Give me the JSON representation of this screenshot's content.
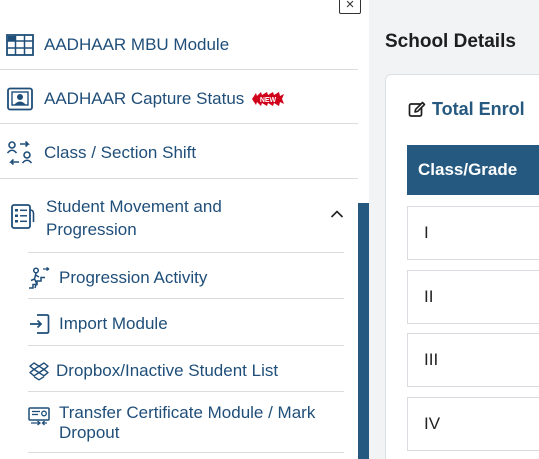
{
  "sidebar": {
    "items": [
      {
        "label": "AADHAAR MBU Module",
        "icon": "table-grid-icon"
      },
      {
        "label": "AADHAAR Capture Status",
        "icon": "id-card-icon",
        "badge": "NEW"
      },
      {
        "label": "Class / Section Shift",
        "icon": "people-swap-icon"
      }
    ],
    "group": {
      "label": "Student Movement and Progression",
      "icon": "clipboard-list-icon",
      "expanded": true,
      "children": [
        {
          "label": "Progression Activity",
          "icon": "person-climb-icon"
        },
        {
          "label": "Import Module",
          "icon": "sign-in-icon"
        },
        {
          "label": "Dropbox/Inactive Student List",
          "icon": "dropbox-icon"
        },
        {
          "label": "Transfer Certificate Module / Mark Dropout",
          "icon": "transfer-certificate-icon"
        }
      ]
    },
    "close_label": "×"
  },
  "main": {
    "title": "School Details",
    "card_title": "Total Enrol",
    "table": {
      "header": "Class/Grade",
      "rows": [
        "I",
        "II",
        "III",
        "IV"
      ]
    }
  },
  "colors": {
    "brand": "#25597f",
    "link": "#1f4e79",
    "badge": "#d0021b"
  }
}
